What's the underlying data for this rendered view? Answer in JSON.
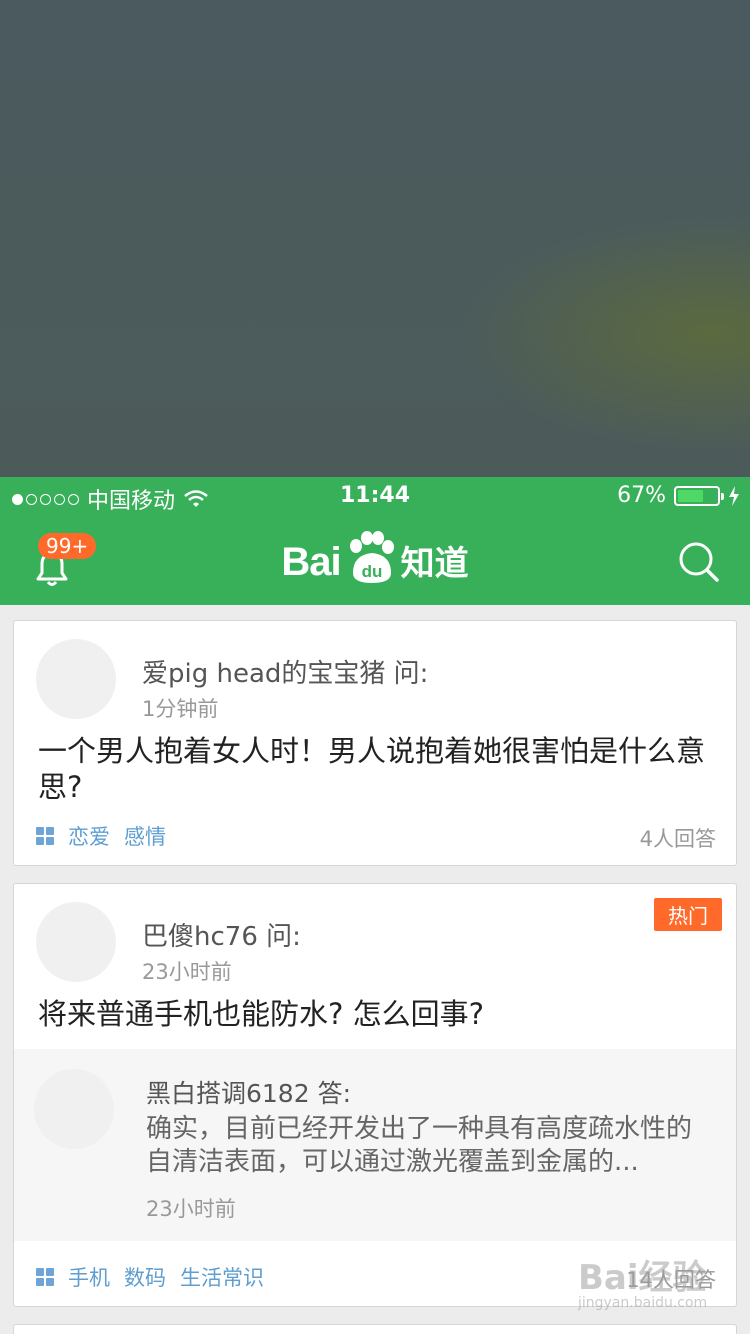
{
  "status_bar": {
    "carrier": "中国移动",
    "time": "11:44",
    "battery": "67%",
    "battery_level": 0.67
  },
  "nav": {
    "notification_badge": "99+",
    "logo_text": "Bai",
    "logo_paw_text": "du",
    "logo_suffix": "知道",
    "icons": {
      "bell": "bell-icon",
      "search": "search-icon"
    }
  },
  "feed": [
    {
      "asker": "爱pig head的宝宝猪 问:",
      "time": "1分钟前",
      "question": "一个男人抱着女人时！男人说抱着她很害怕是什么意思?",
      "tags": [
        "恋爱",
        "感情"
      ],
      "answers": "4人回答"
    },
    {
      "hot_label": "热门",
      "asker": "巴傻hc76 问:",
      "time": "23小时前",
      "question": "将来普通手机也能防水? 怎么回事?",
      "answer": {
        "answerer": "黑白搭调6182 答:",
        "text": "确实，目前已经开发出了一种具有高度疏水性的自清洁表面，可以通过激光覆盖到金属的...",
        "time": "23小时前"
      },
      "tags": [
        "手机",
        "数码",
        "生活常识"
      ],
      "answers": "14人回答"
    }
  ],
  "watermark": {
    "brand": "Bai经验",
    "url": "jingyan.baidu.com"
  },
  "colors": {
    "brand_green": "#38b05a",
    "accent_orange": "#ff6a2a",
    "tag_blue": "#5f9ed0"
  }
}
